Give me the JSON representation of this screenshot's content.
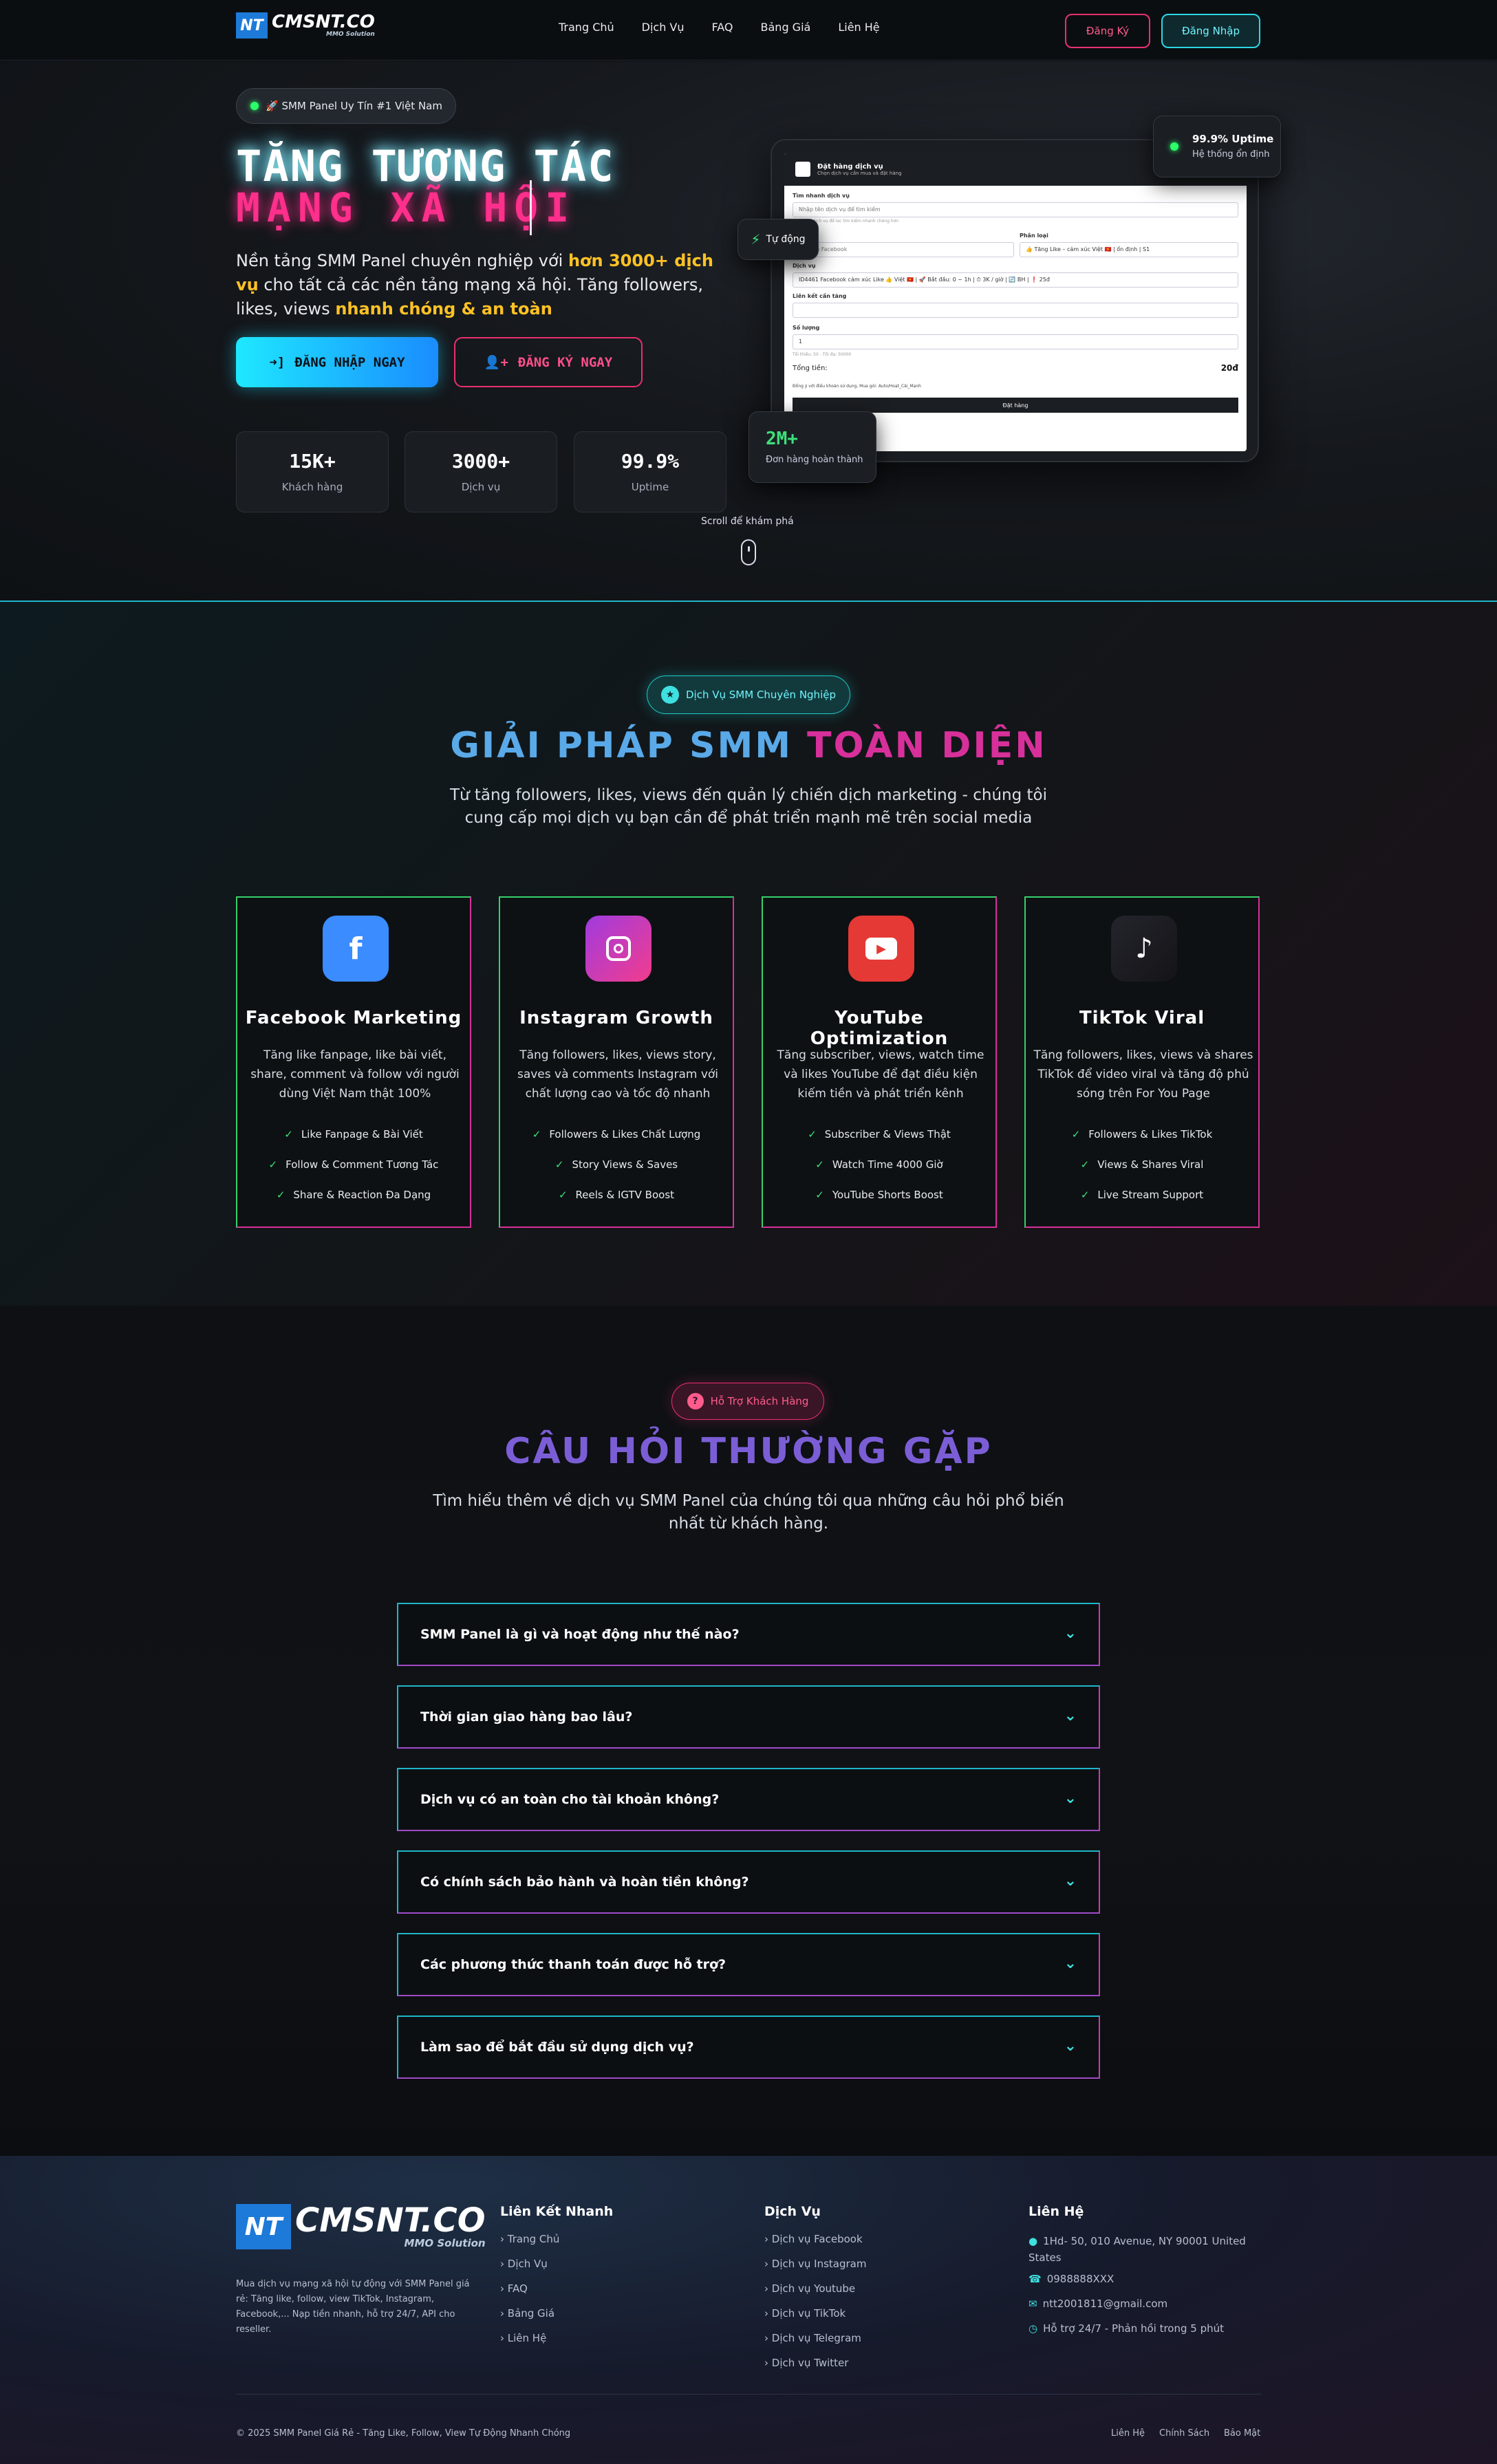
{
  "nav": {
    "logo_text": "CMSNT.CO",
    "logo_sub": "MMO Solution",
    "links": [
      "Trang Chủ",
      "Dịch Vụ",
      "FAQ",
      "Bảng Giá",
      "Liên Hệ"
    ],
    "register": "Đăng Ký",
    "login": "Đăng Nhập"
  },
  "hero": {
    "badge": "🚀 SMM Panel Uy Tín #1 Việt Nam",
    "title_line1": "TĂNG TƯƠNG TÁC",
    "title_line2": "MẠNG XÃ HỘI",
    "lead_pre": "Nền tảng SMM Panel chuyên nghiệp với ",
    "lead_highlight": "hơn 3000+ dịch vụ",
    "lead_mid": " cho tất cả các nền tảng mạng xã hội. Tăng followers, likes, views ",
    "lead_highlight2": "nhanh chóng & an toàn",
    "cta_login": "ĐĂNG NHẬP NGAY",
    "cta_register": "ĐĂNG KÝ NGAY",
    "stats": [
      {
        "value": "15K+",
        "label": "Khách hàng"
      },
      {
        "value": "3000+",
        "label": "Dịch vụ"
      },
      {
        "value": "99.9%",
        "label": "Uptime"
      }
    ],
    "uptime_card": {
      "title": "99.9% Uptime",
      "sub": "Hệ thống ổn định"
    },
    "auto_card": "Tự động",
    "orders_card": {
      "value": "2M+",
      "label": "Đơn hàng hoàn thành"
    },
    "scroll_hint": "Scroll để khám phá",
    "mock": {
      "title": "Đặt hàng dịch vụ",
      "subtitle": "Chọn dịch vụ cần mua và đặt hàng",
      "search_label": "Tìm nhanh dịch vụ",
      "search_placeholder": "Nhập tên dịch vụ để tìm kiếm",
      "search_hint": "Tìm kiếm dịch vụ để lọc tìm kiếm nhanh chóng hơn",
      "platform": "Dịch vụ Facebook",
      "category_label": "Phân loại",
      "category": "👍 Tăng Like – cảm xúc Việt 🇻🇳 | ổn định | S1",
      "service_label": "Dịch vụ",
      "service": "ID4461  Facebook cảm xúc Like 👍 Việt 🇻🇳 | 🚀 Bắt đầu: 0 ~ 1h | ⏱ 3K / giờ | 🔄 BH | ❗  25đ",
      "link_label": "Liên kết cần tăng",
      "qty_label": "Số lượng",
      "qty_value": "1",
      "qty_hint": "Tối thiểu: 50 - Tối đa: 50000",
      "total_label": "Tổng tiền:",
      "total_value": "20đ",
      "terms": "Đồng ý với điều khoản sử dụng, Mua gói: Auto/Hoạt_Cài_Mạnh",
      "submit": "Đặt hàng"
    }
  },
  "services": {
    "badge": "Dịch Vụ SMM Chuyên Nghiệp",
    "title_a": "GIẢI PHÁP SMM",
    "title_b": "TOÀN DIỆN",
    "subtitle": "Từ tăng followers, likes, views đến quản lý chiến dịch marketing - chúng tôi cung cấp mọi dịch vụ bạn cần để phát triển mạnh mẽ trên social media",
    "cards": [
      {
        "icon": "facebook-icon",
        "title": "Facebook Marketing",
        "desc": "Tăng like fanpage, like bài viết, share, comment và follow với người dùng Việt Nam thật 100%",
        "features": [
          "Like Fanpage & Bài Viết",
          "Follow & Comment Tương Tác",
          "Share & Reaction Đa Dạng"
        ],
        "color": "#3b8cff"
      },
      {
        "icon": "instagram-icon",
        "title": "Instagram Growth",
        "desc": "Tăng followers, likes, views story, saves và comments Instagram với chất lượng cao và tốc độ nhanh",
        "features": [
          "Followers & Likes Chất Lượng",
          "Story Views & Saves",
          "Reels & IGTV Boost"
        ],
        "color": "#d7309a"
      },
      {
        "icon": "youtube-icon",
        "title": "YouTube Optimization",
        "desc": "Tăng subscriber, views, watch time và likes YouTube để đạt điều kiện kiếm tiền và phát triển kênh",
        "features": [
          "Subscriber & Views Thật",
          "Watch Time 4000 Giờ",
          "YouTube Shorts Boost"
        ],
        "color": "#e53935"
      },
      {
        "icon": "tiktok-icon",
        "title": "TikTok Viral",
        "desc": "Tăng followers, likes, views và shares TikTok để video viral và tăng độ phủ sóng trên For You Page",
        "features": [
          "Followers & Likes TikTok",
          "Views & Shares Viral",
          "Live Stream Support"
        ],
        "color": "#1b1b22"
      }
    ]
  },
  "faq": {
    "badge": "Hỗ Trợ Khách Hàng",
    "title": "CÂU HỎI THƯỜNG GẶP",
    "subtitle": "Tìm hiểu thêm về dịch vụ SMM Panel của chúng tôi qua những câu hỏi phổ biến nhất từ khách hàng.",
    "questions": [
      "SMM Panel là gì và hoạt động như thế nào?",
      "Thời gian giao hàng bao lâu?",
      "Dịch vụ có an toàn cho tài khoản không?",
      "Có chính sách bảo hành và hoàn tiền không?",
      "Các phương thức thanh toán được hỗ trợ?",
      "Làm sao để bắt đầu sử dụng dịch vụ?"
    ]
  },
  "footer": {
    "about": "Mua dịch vụ mạng xã hội tự động với SMM Panel giá rẻ: Tăng like, follow, view TikTok, Instagram, Facebook,... Nạp tiền nhanh, hỗ trợ 24/7, API cho reseller.",
    "quick_title": "Liên Kết Nhanh",
    "quick": [
      "Trang Chủ",
      "Dịch Vụ",
      "FAQ",
      "Bảng Giá",
      "Liên Hệ"
    ],
    "services_title": "Dịch Vụ",
    "services": [
      "Dịch vụ Facebook",
      "Dịch vụ Instagram",
      "Dịch vụ Youtube",
      "Dịch vụ TikTok",
      "Dịch vụ Telegram",
      "Dịch vụ Twitter"
    ],
    "contact_title": "Liên Hệ",
    "address": "1Hd- 50, 010 Avenue, NY 90001 United States",
    "phone": "0988888XXX",
    "email": "ntt2001811@gmail.com",
    "support": "Hỗ trợ 24/7 - Phản hồi trong 5 phút",
    "copyright": "© 2025 SMM Panel Giá Rẻ - Tăng Like, Follow, View Tự Động Nhanh Chóng",
    "bottom_links": [
      "Liên Hệ",
      "Chính Sách",
      "Bảo Mật"
    ]
  }
}
